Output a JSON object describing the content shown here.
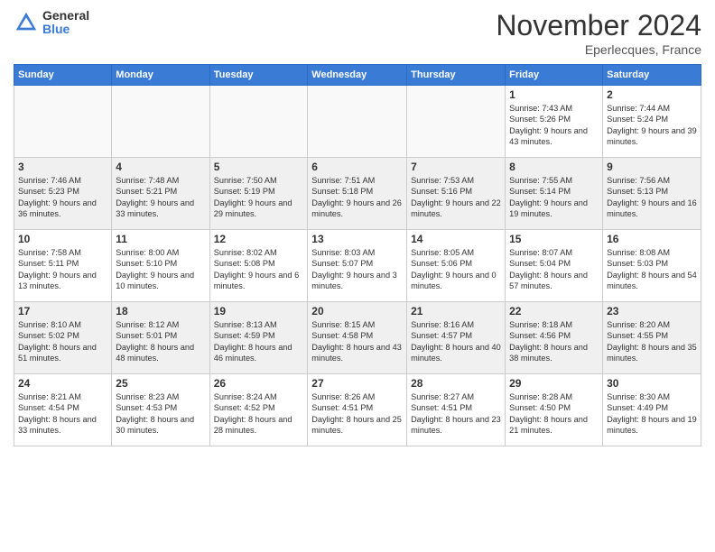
{
  "header": {
    "logo_general": "General",
    "logo_blue": "Blue",
    "title": "November 2024",
    "location": "Eperlecques, France"
  },
  "days_of_week": [
    "Sunday",
    "Monday",
    "Tuesday",
    "Wednesday",
    "Thursday",
    "Friday",
    "Saturday"
  ],
  "weeks": [
    [
      {
        "day": "",
        "info": ""
      },
      {
        "day": "",
        "info": ""
      },
      {
        "day": "",
        "info": ""
      },
      {
        "day": "",
        "info": ""
      },
      {
        "day": "",
        "info": ""
      },
      {
        "day": "1",
        "info": "Sunrise: 7:43 AM\nSunset: 5:26 PM\nDaylight: 9 hours and 43 minutes."
      },
      {
        "day": "2",
        "info": "Sunrise: 7:44 AM\nSunset: 5:24 PM\nDaylight: 9 hours and 39 minutes."
      }
    ],
    [
      {
        "day": "3",
        "info": "Sunrise: 7:46 AM\nSunset: 5:23 PM\nDaylight: 9 hours and 36 minutes."
      },
      {
        "day": "4",
        "info": "Sunrise: 7:48 AM\nSunset: 5:21 PM\nDaylight: 9 hours and 33 minutes."
      },
      {
        "day": "5",
        "info": "Sunrise: 7:50 AM\nSunset: 5:19 PM\nDaylight: 9 hours and 29 minutes."
      },
      {
        "day": "6",
        "info": "Sunrise: 7:51 AM\nSunset: 5:18 PM\nDaylight: 9 hours and 26 minutes."
      },
      {
        "day": "7",
        "info": "Sunrise: 7:53 AM\nSunset: 5:16 PM\nDaylight: 9 hours and 22 minutes."
      },
      {
        "day": "8",
        "info": "Sunrise: 7:55 AM\nSunset: 5:14 PM\nDaylight: 9 hours and 19 minutes."
      },
      {
        "day": "9",
        "info": "Sunrise: 7:56 AM\nSunset: 5:13 PM\nDaylight: 9 hours and 16 minutes."
      }
    ],
    [
      {
        "day": "10",
        "info": "Sunrise: 7:58 AM\nSunset: 5:11 PM\nDaylight: 9 hours and 13 minutes."
      },
      {
        "day": "11",
        "info": "Sunrise: 8:00 AM\nSunset: 5:10 PM\nDaylight: 9 hours and 10 minutes."
      },
      {
        "day": "12",
        "info": "Sunrise: 8:02 AM\nSunset: 5:08 PM\nDaylight: 9 hours and 6 minutes."
      },
      {
        "day": "13",
        "info": "Sunrise: 8:03 AM\nSunset: 5:07 PM\nDaylight: 9 hours and 3 minutes."
      },
      {
        "day": "14",
        "info": "Sunrise: 8:05 AM\nSunset: 5:06 PM\nDaylight: 9 hours and 0 minutes."
      },
      {
        "day": "15",
        "info": "Sunrise: 8:07 AM\nSunset: 5:04 PM\nDaylight: 8 hours and 57 minutes."
      },
      {
        "day": "16",
        "info": "Sunrise: 8:08 AM\nSunset: 5:03 PM\nDaylight: 8 hours and 54 minutes."
      }
    ],
    [
      {
        "day": "17",
        "info": "Sunrise: 8:10 AM\nSunset: 5:02 PM\nDaylight: 8 hours and 51 minutes."
      },
      {
        "day": "18",
        "info": "Sunrise: 8:12 AM\nSunset: 5:01 PM\nDaylight: 8 hours and 48 minutes."
      },
      {
        "day": "19",
        "info": "Sunrise: 8:13 AM\nSunset: 4:59 PM\nDaylight: 8 hours and 46 minutes."
      },
      {
        "day": "20",
        "info": "Sunrise: 8:15 AM\nSunset: 4:58 PM\nDaylight: 8 hours and 43 minutes."
      },
      {
        "day": "21",
        "info": "Sunrise: 8:16 AM\nSunset: 4:57 PM\nDaylight: 8 hours and 40 minutes."
      },
      {
        "day": "22",
        "info": "Sunrise: 8:18 AM\nSunset: 4:56 PM\nDaylight: 8 hours and 38 minutes."
      },
      {
        "day": "23",
        "info": "Sunrise: 8:20 AM\nSunset: 4:55 PM\nDaylight: 8 hours and 35 minutes."
      }
    ],
    [
      {
        "day": "24",
        "info": "Sunrise: 8:21 AM\nSunset: 4:54 PM\nDaylight: 8 hours and 33 minutes."
      },
      {
        "day": "25",
        "info": "Sunrise: 8:23 AM\nSunset: 4:53 PM\nDaylight: 8 hours and 30 minutes."
      },
      {
        "day": "26",
        "info": "Sunrise: 8:24 AM\nSunset: 4:52 PM\nDaylight: 8 hours and 28 minutes."
      },
      {
        "day": "27",
        "info": "Sunrise: 8:26 AM\nSunset: 4:51 PM\nDaylight: 8 hours and 25 minutes."
      },
      {
        "day": "28",
        "info": "Sunrise: 8:27 AM\nSunset: 4:51 PM\nDaylight: 8 hours and 23 minutes."
      },
      {
        "day": "29",
        "info": "Sunrise: 8:28 AM\nSunset: 4:50 PM\nDaylight: 8 hours and 21 minutes."
      },
      {
        "day": "30",
        "info": "Sunrise: 8:30 AM\nSunset: 4:49 PM\nDaylight: 8 hours and 19 minutes."
      }
    ]
  ]
}
